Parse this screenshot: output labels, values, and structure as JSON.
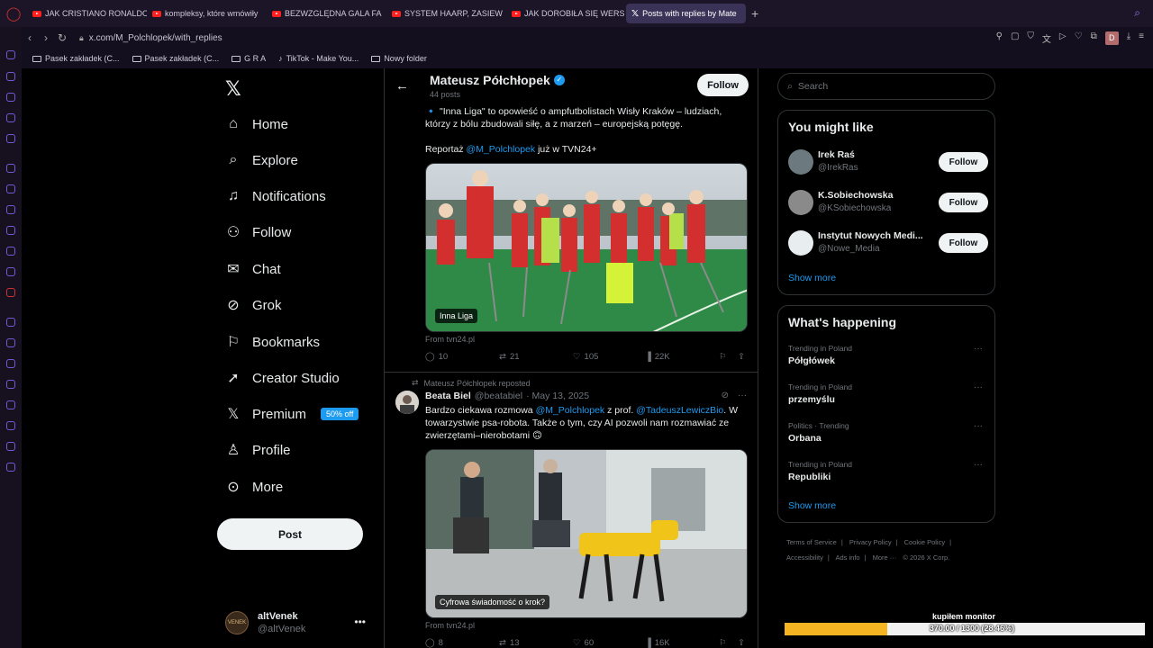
{
  "browser": {
    "tabs": [
      {
        "label": "JAK CRISTIANO RONALDO",
        "type": "youtube"
      },
      {
        "label": "kompleksy, które wmówiły",
        "type": "youtube"
      },
      {
        "label": "BEZWZGLĘDNA GALA FA",
        "type": "youtube"
      },
      {
        "label": "SYSTEM HAARP, ZASIEW",
        "type": "youtube"
      },
      {
        "label": "JAK DOROBIŁA SIĘ WERS",
        "type": "youtube"
      },
      {
        "label": "Posts with replies by Mate",
        "type": "x",
        "active": true
      }
    ],
    "url": "x.com/M_Polchlopek/with_replies",
    "profile_initial": "D",
    "bookmarks": [
      "Pasek zakładek (C...",
      "Pasek zakładek (C...",
      "G R A",
      "TikTok - Make You...",
      "Nowy folder"
    ]
  },
  "nav": {
    "items": [
      {
        "label": "Home",
        "icon": "home-icon"
      },
      {
        "label": "Explore",
        "icon": "search-icon"
      },
      {
        "label": "Notifications",
        "icon": "bell-icon"
      },
      {
        "label": "Follow",
        "icon": "add-user-icon"
      },
      {
        "label": "Chat",
        "icon": "mail-icon"
      },
      {
        "label": "Grok",
        "icon": "grok-icon"
      },
      {
        "label": "Bookmarks",
        "icon": "bookmark-icon"
      },
      {
        "label": "Creator Studio",
        "icon": "rocket-icon"
      },
      {
        "label": "Premium",
        "icon": "x-icon"
      },
      {
        "label": "Profile",
        "icon": "person-icon"
      },
      {
        "label": "More",
        "icon": "more-circle-icon"
      }
    ],
    "premium_badge": "50% off",
    "post_label": "Post",
    "account": {
      "name": "altVenek",
      "handle": "@altVenek",
      "avatar_text": "VENEK"
    }
  },
  "profile": {
    "name": "Mateusz Półchłopek",
    "post_count": "44 posts",
    "follow_label": "Follow"
  },
  "tweet1": {
    "line1_prefix": "\"Inna Liga\" to opowieść o ampfutbolistach Wisły Kraków – ludziach,",
    "line2": "którzy z bólu zbudowali siłę, a z marzeń – europejską potęgę.",
    "line3_prefix": "Reportaż ",
    "line3_link": "@M_Polchlopek",
    "line3_suffix": " już w TVN24+",
    "media_caption": "Inna Liga",
    "from": "From tvn24.pl",
    "replies": "10",
    "reposts": "21",
    "likes": "105",
    "views": "22K"
  },
  "tweet2": {
    "reposted_by": "Mateusz Półchłopek reposted",
    "author_name": "Beata Biel",
    "author_handle": "@beatabiel",
    "date": "· May 13, 2025",
    "text_a": "Bardzo ciekawa rozmowa ",
    "link_a": "@M_Polchlopek",
    "text_b": " z prof. ",
    "link_b": "@TadeuszLewiczBio",
    "text_c": ". W",
    "line2": "towarzystwie psa-robota. Także o tym, czy AI pozwoli nam rozmawiać ze",
    "line3": "zwierzętami–nierobotami 🙃",
    "media_caption": "Cyfrowa świadomość o krok?",
    "from": "From tvn24.pl",
    "replies": "8",
    "reposts": "13",
    "likes": "60",
    "views": "16K"
  },
  "right": {
    "search_placeholder": "Search",
    "might_like_title": "You might like",
    "suggestions": [
      {
        "name": "Irek Raś",
        "handle": "@IrekRas",
        "follow": "Follow"
      },
      {
        "name": "K.Sobiechowska",
        "handle": "@KSobiechowska",
        "follow": "Follow"
      },
      {
        "name": "Instytut Nowych Medi...",
        "handle": "@Nowe_Media",
        "follow": "Follow"
      }
    ],
    "show_more": "Show more",
    "happening_title": "What's happening",
    "trends": [
      {
        "context": "Trending in Poland",
        "topic": "Półgłówek"
      },
      {
        "context": "Trending in Poland",
        "topic": "przemyślu"
      },
      {
        "context": "Politics · Trending",
        "topic": "Orbana"
      },
      {
        "context": "Trending in Poland",
        "topic": "Republiki"
      }
    ],
    "show_more_2": "Show more",
    "footer": [
      "Terms of Service",
      "|",
      "Privacy Policy",
      "|",
      "Cookie Policy",
      "|",
      "Accessibility",
      "|",
      "Ads info",
      "|",
      "More ···",
      "© 2026 X Corp."
    ]
  },
  "overlay": {
    "label": "kupiłem monitor",
    "progress_text": "370.00 / 1300 (28.46%)",
    "progress_fraction": 0.2846,
    "fill_color": "#f5b523"
  }
}
